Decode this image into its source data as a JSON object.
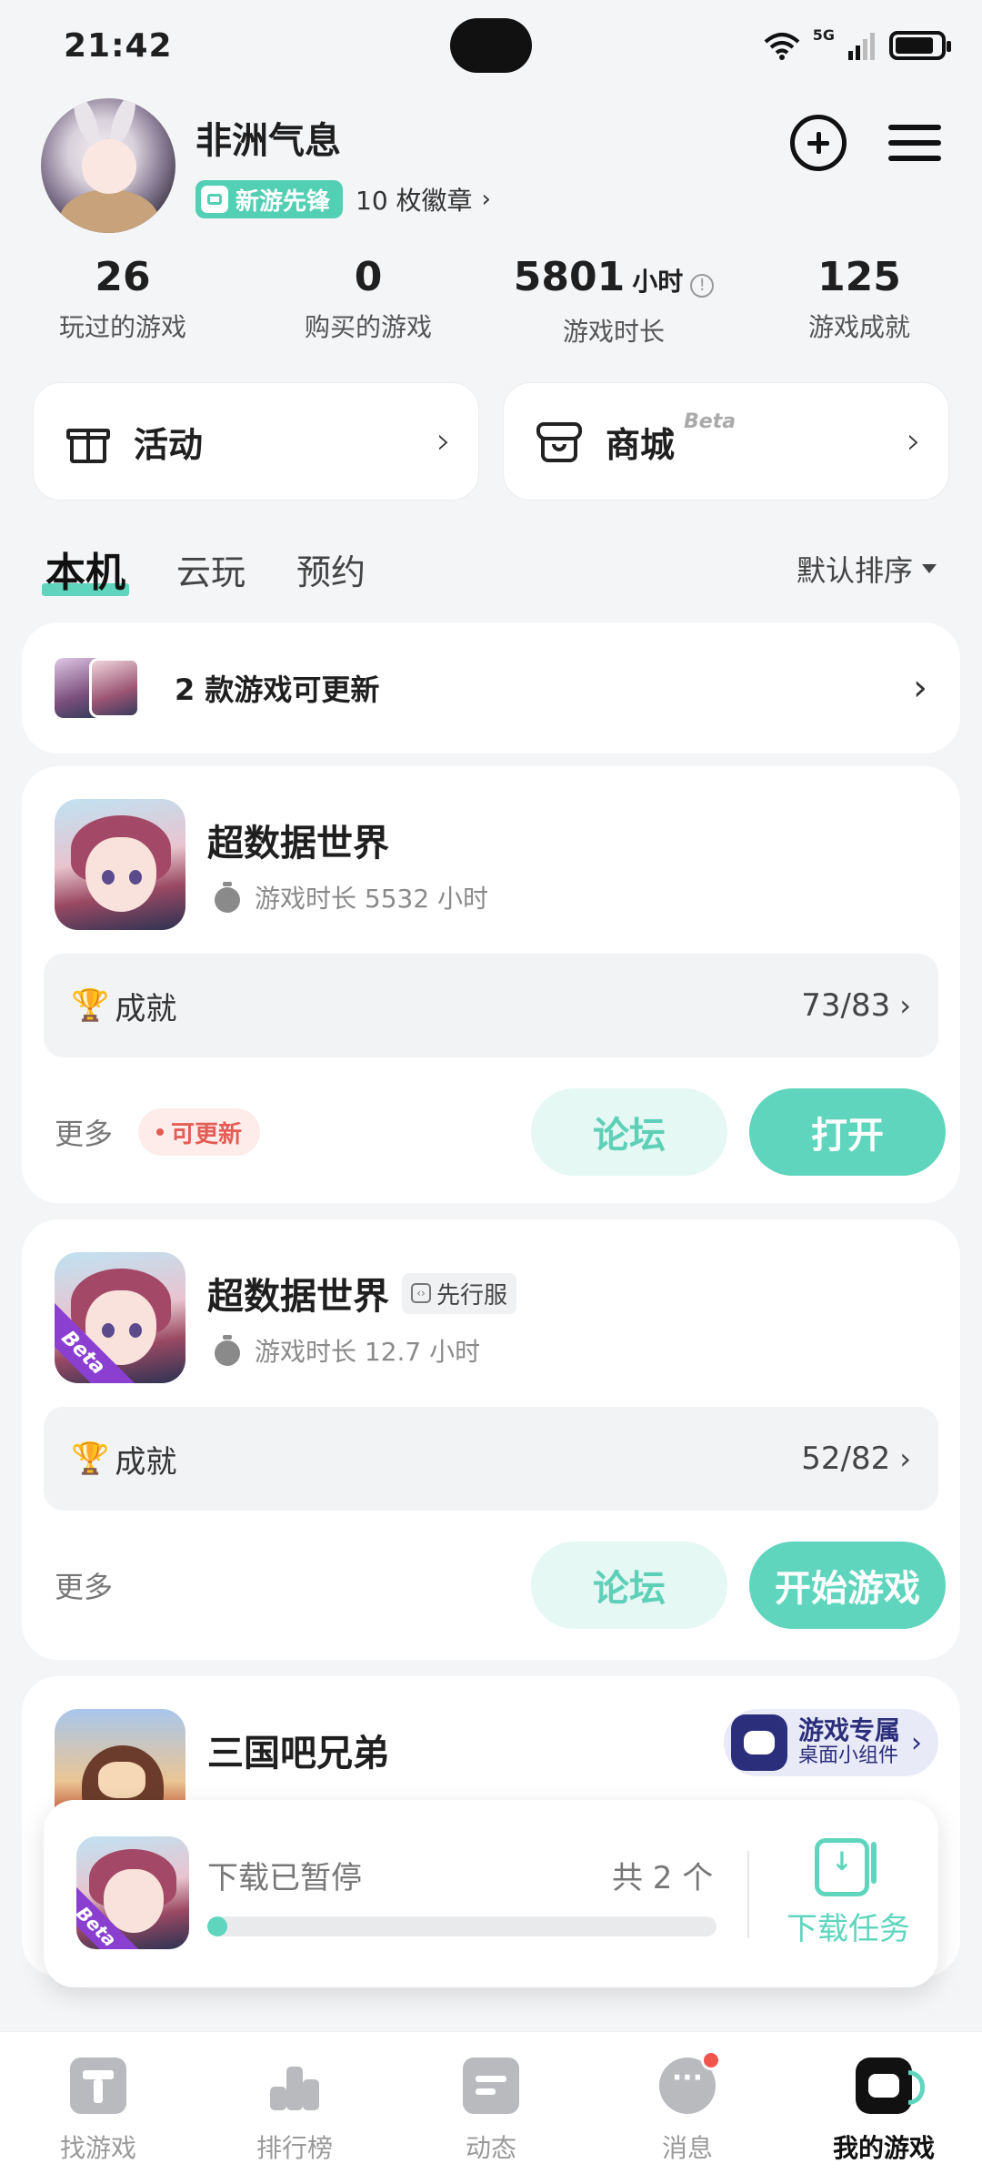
{
  "status_bar": {
    "time": "21:42",
    "network": "5G"
  },
  "profile": {
    "username": "非洲气息",
    "level_badge": "新游先锋",
    "medals_link": "10 枚徽章"
  },
  "stats": [
    {
      "value": "26",
      "unit": "",
      "label": "玩过的游戏"
    },
    {
      "value": "0",
      "unit": "",
      "label": "购买的游戏"
    },
    {
      "value": "5801",
      "unit": "小时",
      "label": "游戏时长"
    },
    {
      "value": "125",
      "unit": "",
      "label": "游戏成就"
    }
  ],
  "quick_cards": [
    {
      "label": "活动",
      "icon": "gift-icon",
      "tag": ""
    },
    {
      "label": "商城",
      "icon": "store-icon",
      "tag": "Beta"
    }
  ],
  "tabs": [
    {
      "label": "本机",
      "active": true
    },
    {
      "label": "云玩",
      "active": false
    },
    {
      "label": "预约",
      "active": false
    }
  ],
  "sort_label": "默认排序",
  "update_banner": {
    "text": "2 款游戏可更新"
  },
  "games": [
    {
      "title": "超数据世界",
      "server_tag": "",
      "playtime": "游戏时长 5532 小时",
      "achievement_label": "成就",
      "achievement_count": "73/83",
      "more": "更多",
      "update_tag": "可更新",
      "forum_button": "论坛",
      "primary_button": "打开",
      "beta": false
    },
    {
      "title": "超数据世界",
      "server_tag": "先行服",
      "playtime": "游戏时长 12.7 小时",
      "achievement_label": "成就",
      "achievement_count": "52/82",
      "more": "更多",
      "update_tag": "",
      "forum_button": "论坛",
      "primary_button": "开始游戏",
      "beta": true
    },
    {
      "title": "三国吧兄弟",
      "widget_main": "游戏专属",
      "widget_sub": "桌面小组件"
    }
  ],
  "download_panel": {
    "title": "下载已暂停",
    "count": "共 2 个",
    "task_label": "下载任务",
    "progress": 0.0,
    "beta_label": "Beta"
  },
  "bottom_nav": [
    {
      "label": "找游戏",
      "icon": "find-games-icon",
      "active": false
    },
    {
      "label": "排行榜",
      "icon": "ranking-icon",
      "active": false
    },
    {
      "label": "动态",
      "icon": "feed-icon",
      "active": false
    },
    {
      "label": "消息",
      "icon": "message-icon",
      "active": false,
      "unread": true
    },
    {
      "label": "我的游戏",
      "icon": "my-games-icon",
      "active": true
    }
  ],
  "colors": {
    "accent": "#5fd5bd",
    "alert": "#e35d56",
    "beta": "#8b3fd1"
  }
}
